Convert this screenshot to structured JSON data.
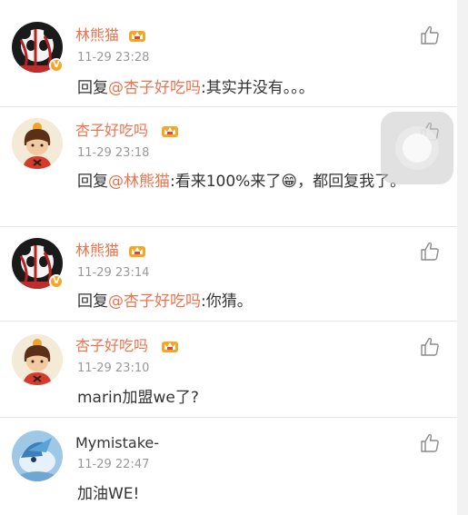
{
  "comments": [
    {
      "name": "林熊猫",
      "time": "11-29 23:28",
      "reply_prefix": "回复",
      "mention": "@杏子好吃吗",
      "text": ":其实并没有。。。",
      "verified_badge": "V",
      "avatar": "panda-avatar"
    },
    {
      "name": "杏子好吃吗",
      "time": "11-29 23:18",
      "reply_prefix": "回复",
      "mention": "@林熊猫",
      "text": ":看来100%来了",
      "emoji": "😁",
      "text_after": "，都回复我了。",
      "avatar": "cartoon-boy-avatar"
    },
    {
      "name": "林熊猫",
      "time": "11-29 23:14",
      "reply_prefix": "回复",
      "mention": "@杏子好吃吗",
      "text": ":你猜。",
      "verified_badge": "V",
      "avatar": "panda-avatar"
    },
    {
      "name": "杏子好吃吗",
      "time": "11-29 23:10",
      "text": "marin加盟we了?",
      "avatar": "cartoon-boy-avatar"
    },
    {
      "name": "Mymistake-",
      "time": "11-29 22:47",
      "text": "加油WE!",
      "avatar": "blue-creature-avatar"
    }
  ],
  "colors": {
    "accent": "#eb7350",
    "text": "#333333",
    "muted": "#999999",
    "divider": "#e6e6e6",
    "vip_gold": "#f5a623"
  }
}
